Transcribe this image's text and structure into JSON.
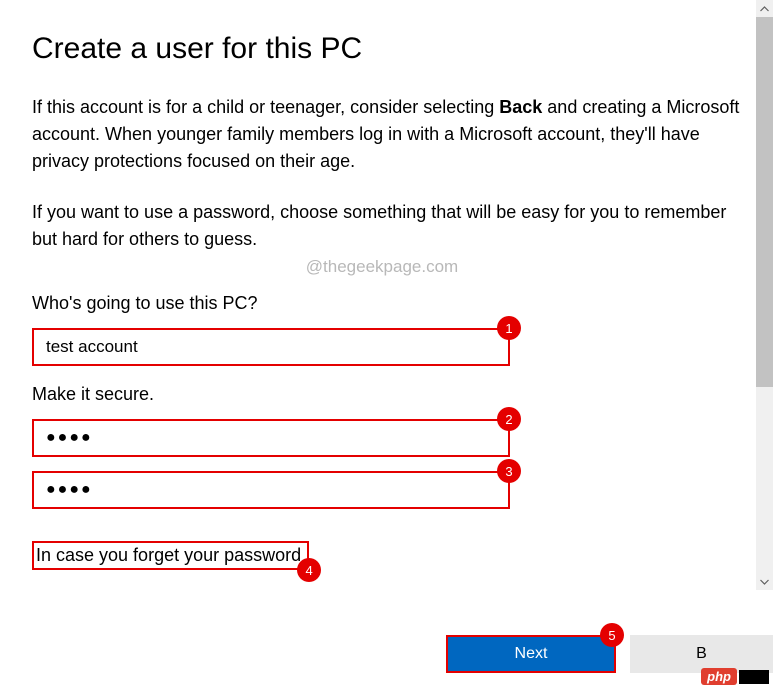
{
  "title": "Create a user for this PC",
  "intro": {
    "p1_pre": "If this account is for a child or teenager, consider selecting ",
    "p1_bold": "Back",
    "p1_post": " and creating a Microsoft account. When younger family members log in with a Microsoft account, they'll have privacy protections focused on their age.",
    "p2": "If you want to use a password, choose something that will be easy for you to remember but hard for others to guess."
  },
  "watermark": "@thegeekpage.com",
  "sections": {
    "who_label": "Who's going to use this PC?",
    "secure_label": "Make it secure.",
    "forget_label": "In case you forget your password"
  },
  "fields": {
    "username_value": "test account",
    "password_value": "●●●●",
    "confirm_value": "●●●●"
  },
  "badges": {
    "b1": "1",
    "b2": "2",
    "b3": "3",
    "b4": "4",
    "b5": "5"
  },
  "buttons": {
    "next": "Next",
    "secondary": "B"
  },
  "overlay": {
    "php": "php"
  }
}
